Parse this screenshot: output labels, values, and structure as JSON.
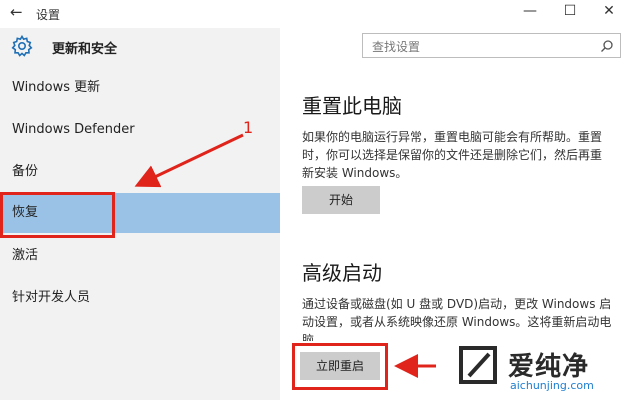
{
  "window": {
    "back_glyph": "←",
    "title": "设置",
    "minimize_glyph": "—",
    "maximize_glyph": "☐",
    "close_glyph": "✕"
  },
  "header": {
    "section_title": "更新和安全",
    "search_placeholder": "查找设置"
  },
  "sidebar": {
    "items": [
      {
        "label": "Windows 更新",
        "selected": false
      },
      {
        "label": "Windows Defender",
        "selected": false
      },
      {
        "label": "备份",
        "selected": false
      },
      {
        "label": "恢复",
        "selected": true
      },
      {
        "label": "激活",
        "selected": false
      },
      {
        "label": "针对开发人员",
        "selected": false
      }
    ]
  },
  "main": {
    "reset": {
      "heading": "重置此电脑",
      "description": "如果你的电脑运行异常，重置电脑可能会有所帮助。重置时，你可以选择是保留你的文件还是删除它们，然后再重新安装 Windows。",
      "button": "开始"
    },
    "advanced": {
      "heading": "高级启动",
      "description": "通过设备或磁盘(如 U 盘或 DVD)启动，更改 Windows 启动设置，或者从系统映像还原 Windows。这将重新启动电脑",
      "button": "立即重启"
    }
  },
  "annotation": {
    "number": "1",
    "color": "#e0241b"
  },
  "watermark": {
    "name": "爱纯净",
    "url": "aichunjing.com"
  },
  "colors": {
    "selected_bg": "#99c2e6",
    "sidebar_bg": "#f2f2f2",
    "button_bg": "#cccccc",
    "annotation": "#e0241b",
    "watermark_url": "#1f7fd0"
  }
}
